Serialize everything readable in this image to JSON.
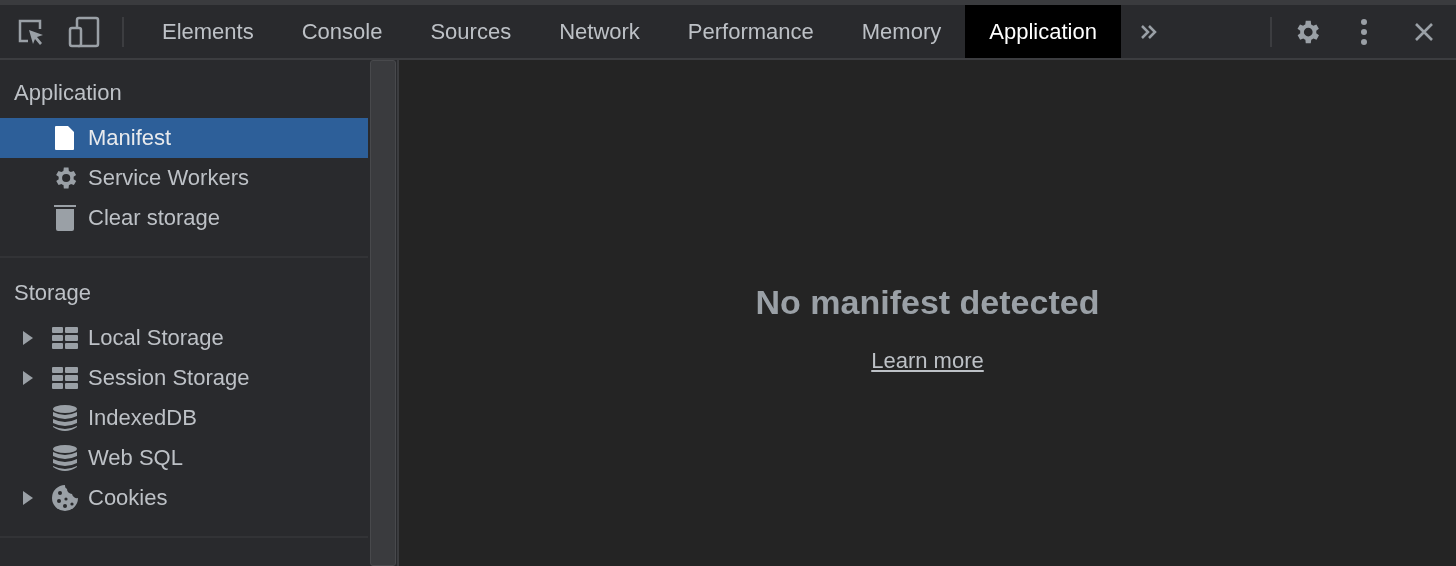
{
  "toolbar": {
    "tabs": [
      {
        "label": "Elements",
        "selected": false
      },
      {
        "label": "Console",
        "selected": false
      },
      {
        "label": "Sources",
        "selected": false
      },
      {
        "label": "Network",
        "selected": false
      },
      {
        "label": "Performance",
        "selected": false
      },
      {
        "label": "Memory",
        "selected": false
      },
      {
        "label": "Application",
        "selected": true
      }
    ]
  },
  "sidebar": {
    "sections": [
      {
        "title": "Application",
        "items": [
          {
            "label": "Manifest",
            "kind": "file",
            "expandable": false,
            "selected": true
          },
          {
            "label": "Service Workers",
            "kind": "gear",
            "expandable": false,
            "selected": false
          },
          {
            "label": "Clear storage",
            "kind": "trash",
            "expandable": false,
            "selected": false
          }
        ]
      },
      {
        "title": "Storage",
        "items": [
          {
            "label": "Local Storage",
            "kind": "table",
            "expandable": true,
            "selected": false
          },
          {
            "label": "Session Storage",
            "kind": "table",
            "expandable": true,
            "selected": false
          },
          {
            "label": "IndexedDB",
            "kind": "database",
            "expandable": false,
            "selected": false
          },
          {
            "label": "Web SQL",
            "kind": "database",
            "expandable": false,
            "selected": false
          },
          {
            "label": "Cookies",
            "kind": "cookie",
            "expandable": true,
            "selected": false
          }
        ]
      }
    ]
  },
  "main": {
    "message": "No manifest detected",
    "link": "Learn more"
  }
}
